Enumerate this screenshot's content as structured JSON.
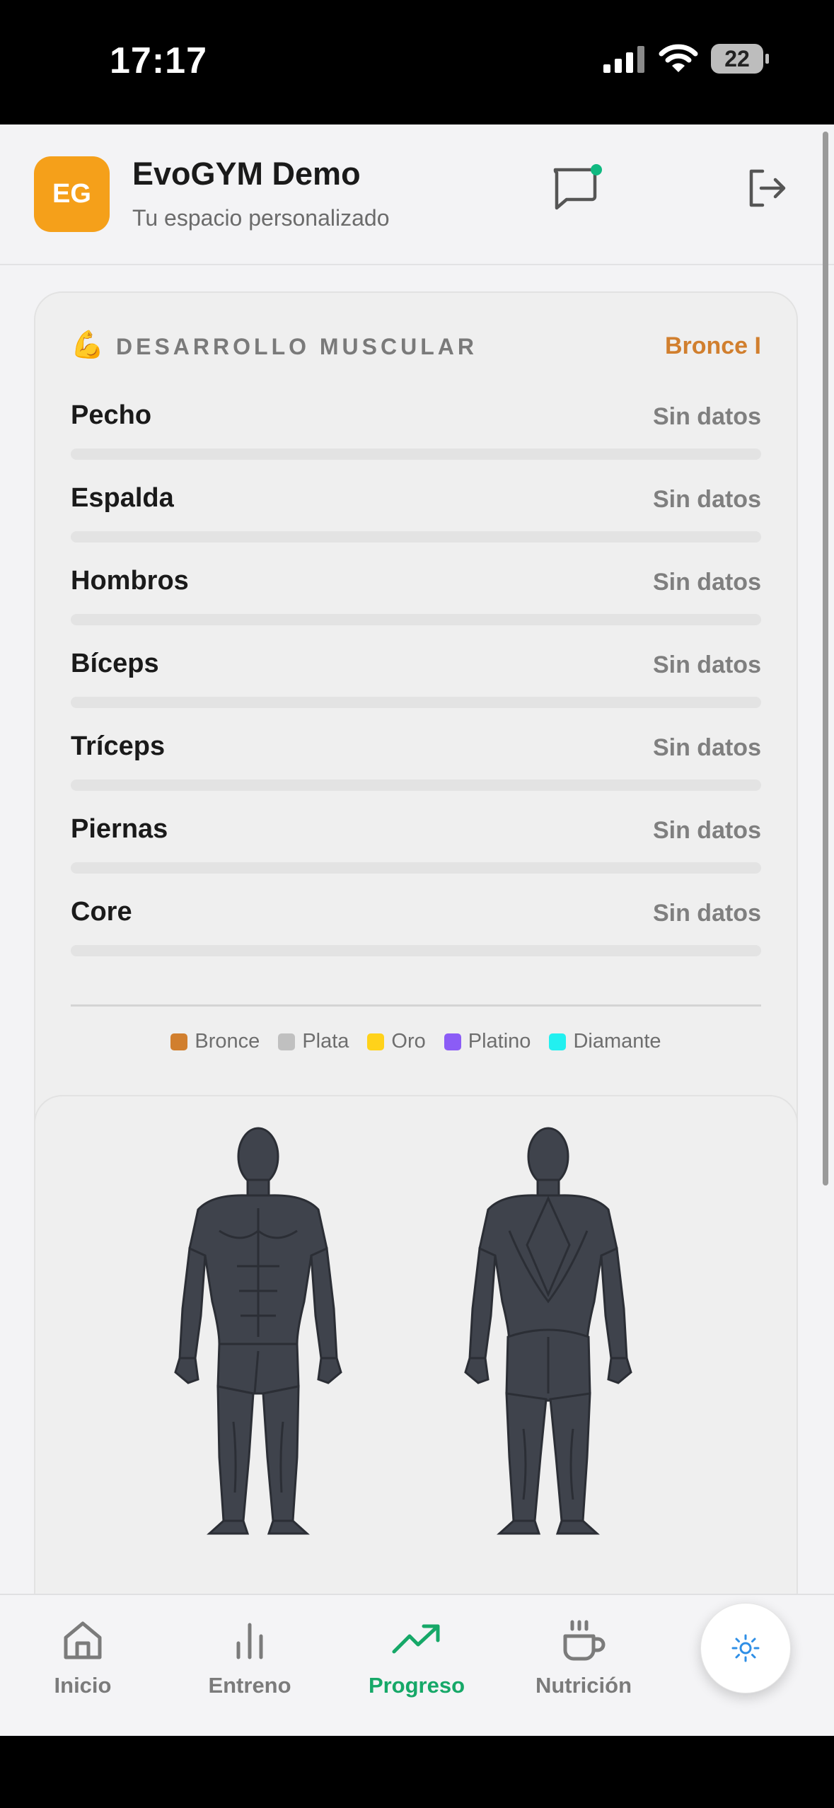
{
  "status_bar": {
    "time": "17:17",
    "battery": "22"
  },
  "header": {
    "avatar_initials": "EG",
    "title": "EvoGYM Demo",
    "subtitle": "Tu espacio personalizado",
    "chat_icon": "chat-bubble-icon",
    "logout_icon": "logout-icon"
  },
  "muscle_card": {
    "emoji": "💪",
    "title": "DESARROLLO MUSCULAR",
    "rank": "Bronce I",
    "muscles": [
      {
        "name": "Pecho",
        "status": "Sin datos",
        "progress": 0
      },
      {
        "name": "Espalda",
        "status": "Sin datos",
        "progress": 0
      },
      {
        "name": "Hombros",
        "status": "Sin datos",
        "progress": 0
      },
      {
        "name": "Bíceps",
        "status": "Sin datos",
        "progress": 0
      },
      {
        "name": "Tríceps",
        "status": "Sin datos",
        "progress": 0
      },
      {
        "name": "Piernas",
        "status": "Sin datos",
        "progress": 0
      },
      {
        "name": "Core",
        "status": "Sin datos",
        "progress": 0
      }
    ],
    "legend": [
      {
        "label": "Bronce",
        "color": "#d17f2e"
      },
      {
        "label": "Plata",
        "color": "#c0c0c0"
      },
      {
        "label": "Oro",
        "color": "#ffd21a"
      },
      {
        "label": "Platino",
        "color": "#8b5cf6"
      },
      {
        "label": "Diamante",
        "color": "#22f0f0"
      }
    ]
  },
  "body_map": {
    "front_icon": "body-front-figure",
    "back_icon": "body-back-figure"
  },
  "tabbar": {
    "tabs": [
      {
        "label": "Inicio",
        "icon": "home-icon",
        "active": false
      },
      {
        "label": "Entreno",
        "icon": "bar-chart-icon",
        "active": false
      },
      {
        "label": "Progreso",
        "icon": "trending-up-icon",
        "active": true
      },
      {
        "label": "Nutrición",
        "icon": "coffee-cup-icon",
        "active": false
      }
    ],
    "fab_icon": "sun-icon"
  },
  "colors": {
    "accent": "#16a868",
    "avatar": "#f5a01a",
    "rank": "#d17f2e",
    "figure": "#3f434c"
  }
}
